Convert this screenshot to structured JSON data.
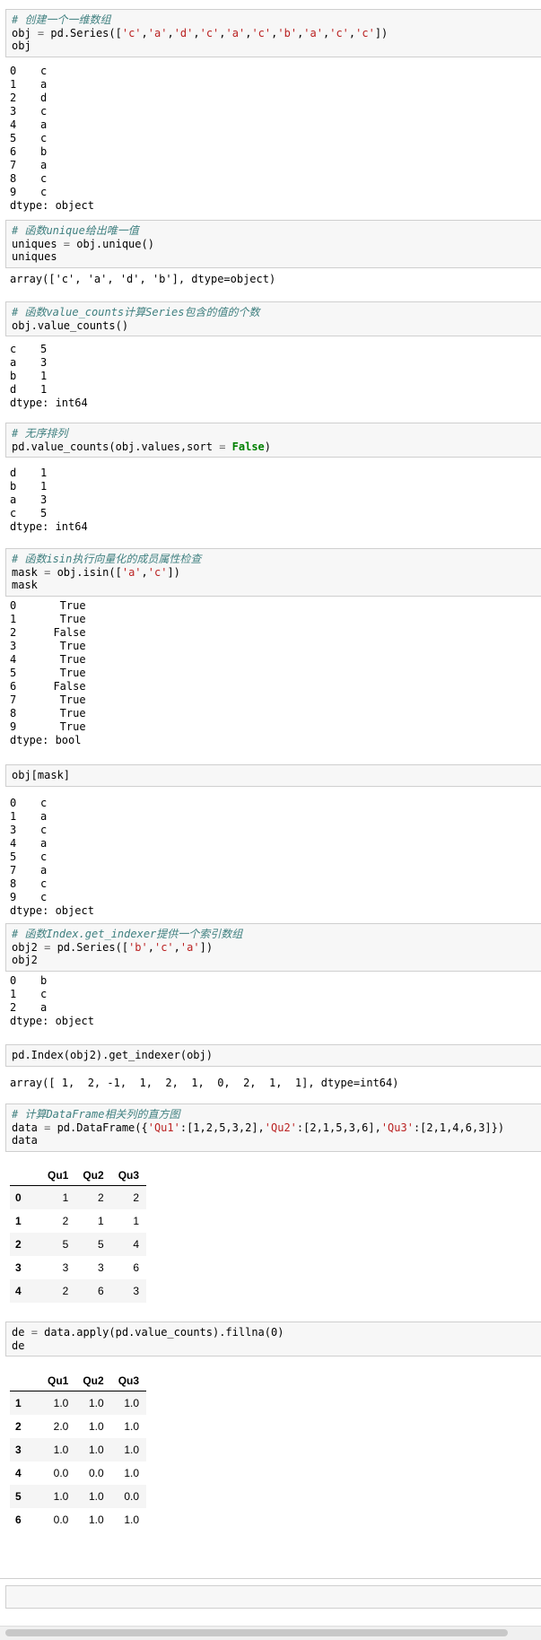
{
  "cells": [
    {
      "input": [
        [
          {
            "t": "# 创建一个一维数组",
            "c": "cm"
          }
        ],
        [
          {
            "t": "obj "
          },
          {
            "t": "=",
            "c": "op"
          },
          {
            "t": " pd.Series(["
          },
          {
            "t": "'c'",
            "c": "st"
          },
          {
            "t": ","
          },
          {
            "t": "'a'",
            "c": "st"
          },
          {
            "t": ","
          },
          {
            "t": "'d'",
            "c": "st"
          },
          {
            "t": ","
          },
          {
            "t": "'c'",
            "c": "st"
          },
          {
            "t": ","
          },
          {
            "t": "'a'",
            "c": "st"
          },
          {
            "t": ","
          },
          {
            "t": "'c'",
            "c": "st"
          },
          {
            "t": ","
          },
          {
            "t": "'b'",
            "c": "st"
          },
          {
            "t": ","
          },
          {
            "t": "'a'",
            "c": "st"
          },
          {
            "t": ","
          },
          {
            "t": "'c'",
            "c": "st"
          },
          {
            "t": ","
          },
          {
            "t": "'c'",
            "c": "st"
          },
          {
            "t": "])"
          }
        ],
        [
          {
            "t": "obj"
          }
        ]
      ],
      "output": {
        "series": [
          [
            "0",
            "c"
          ],
          [
            "1",
            "a"
          ],
          [
            "2",
            "d"
          ],
          [
            "3",
            "c"
          ],
          [
            "4",
            "a"
          ],
          [
            "5",
            "c"
          ],
          [
            "6",
            "b"
          ],
          [
            "7",
            "a"
          ],
          [
            "8",
            "c"
          ],
          [
            "9",
            "c"
          ]
        ],
        "dtype": "dtype: object"
      }
    },
    {
      "input": [
        [
          {
            "t": "# 函数unique给出唯一值",
            "c": "cm"
          }
        ],
        [
          {
            "t": "uniques "
          },
          {
            "t": "=",
            "c": "op"
          },
          {
            "t": " obj.unique()"
          }
        ],
        [
          {
            "t": "uniques"
          }
        ]
      ],
      "output": {
        "text": [
          "array(['c', 'a', 'd', 'b'], dtype=object)"
        ]
      }
    },
    {
      "input": [
        [
          {
            "t": "# 函数value_counts计算Series包含的值的个数",
            "c": "cm"
          }
        ],
        [
          {
            "t": "obj.value_counts()"
          }
        ]
      ],
      "output": {
        "series": [
          [
            "c",
            "5"
          ],
          [
            "a",
            "3"
          ],
          [
            "b",
            "1"
          ],
          [
            "d",
            "1"
          ]
        ],
        "dtype": "dtype: int64"
      }
    },
    {
      "input": [
        [
          {
            "t": "# 无序排列",
            "c": "cm"
          }
        ],
        [
          {
            "t": "pd.value_counts(obj.values,sort "
          },
          {
            "t": "=",
            "c": "op"
          },
          {
            "t": " "
          },
          {
            "t": "False",
            "c": "kw"
          },
          {
            "t": ")"
          }
        ]
      ],
      "output": {
        "series": [
          [
            "d",
            "1"
          ],
          [
            "b",
            "1"
          ],
          [
            "a",
            "3"
          ],
          [
            "c",
            "5"
          ]
        ],
        "dtype": "dtype: int64"
      }
    },
    {
      "input": [
        [
          {
            "t": "# 函数isin执行向量化的成员属性检查",
            "c": "cm"
          }
        ],
        [
          {
            "t": "mask "
          },
          {
            "t": "=",
            "c": "op"
          },
          {
            "t": " obj.isin(["
          },
          {
            "t": "'a'",
            "c": "st"
          },
          {
            "t": ","
          },
          {
            "t": "'c'",
            "c": "st"
          },
          {
            "t": "])"
          }
        ],
        [
          {
            "t": "mask"
          }
        ]
      ],
      "output": {
        "series": [
          [
            "0",
            "   True"
          ],
          [
            "1",
            "   True"
          ],
          [
            "2",
            "  False"
          ],
          [
            "3",
            "   True"
          ],
          [
            "4",
            "   True"
          ],
          [
            "5",
            "   True"
          ],
          [
            "6",
            "  False"
          ],
          [
            "7",
            "   True"
          ],
          [
            "8",
            "   True"
          ],
          [
            "9",
            "   True"
          ]
        ],
        "dtype": "dtype: bool"
      }
    },
    {
      "input": [
        [
          {
            "t": "obj[mask]"
          }
        ]
      ],
      "output": {
        "series": [
          [
            "0",
            "c"
          ],
          [
            "1",
            "a"
          ],
          [
            "3",
            "c"
          ],
          [
            "4",
            "a"
          ],
          [
            "5",
            "c"
          ],
          [
            "7",
            "a"
          ],
          [
            "8",
            "c"
          ],
          [
            "9",
            "c"
          ]
        ],
        "dtype": "dtype: object"
      }
    },
    {
      "input": [
        [
          {
            "t": "# 函数Index.get_indexer提供一个索引数组",
            "c": "cm"
          }
        ],
        [
          {
            "t": "obj2 "
          },
          {
            "t": "=",
            "c": "op"
          },
          {
            "t": " pd.Series(["
          },
          {
            "t": "'b'",
            "c": "st"
          },
          {
            "t": ","
          },
          {
            "t": "'c'",
            "c": "st"
          },
          {
            "t": ","
          },
          {
            "t": "'a'",
            "c": "st"
          },
          {
            "t": "])"
          }
        ],
        [
          {
            "t": "obj2"
          }
        ]
      ],
      "output": {
        "series": [
          [
            "0",
            "b"
          ],
          [
            "1",
            "c"
          ],
          [
            "2",
            "a"
          ]
        ],
        "dtype": "dtype: object"
      }
    },
    {
      "input": [
        [
          {
            "t": "pd.Index(obj2).get_indexer(obj)"
          }
        ]
      ],
      "output": {
        "text": [
          "array([ 1,  2, -1,  1,  2,  1,  0,  2,  1,  1], dtype=int64)"
        ]
      }
    },
    {
      "input": [
        [
          {
            "t": "# 计算DataFrame相关列的直方图",
            "c": "cm"
          }
        ],
        [
          {
            "t": "data "
          },
          {
            "t": "=",
            "c": "op"
          },
          {
            "t": " pd.DataFrame({"
          },
          {
            "t": "'Qu1'",
            "c": "st"
          },
          {
            "t": ":[1,2,5,3,2],"
          },
          {
            "t": "'Qu2'",
            "c": "st"
          },
          {
            "t": ":[2,1,5,3,6],"
          },
          {
            "t": "'Qu3'",
            "c": "st"
          },
          {
            "t": ":[2,1,4,6,3]})"
          }
        ],
        [
          {
            "t": "data"
          }
        ]
      ],
      "output": {
        "table": {
          "columns": [
            "",
            "Qu1",
            "Qu2",
            "Qu3"
          ],
          "rows": [
            [
              "0",
              "1",
              "2",
              "2"
            ],
            [
              "1",
              "2",
              "1",
              "1"
            ],
            [
              "2",
              "5",
              "5",
              "4"
            ],
            [
              "3",
              "3",
              "3",
              "6"
            ],
            [
              "4",
              "2",
              "6",
              "3"
            ]
          ]
        }
      }
    },
    {
      "input": [
        [
          {
            "t": "de "
          },
          {
            "t": "=",
            "c": "op"
          },
          {
            "t": " data.apply(pd.value_counts).fillna(0)"
          }
        ],
        [
          {
            "t": "de"
          }
        ]
      ],
      "output": {
        "table": {
          "columns": [
            "",
            "Qu1",
            "Qu2",
            "Qu3"
          ],
          "rows": [
            [
              "1",
              "1.0",
              "1.0",
              "1.0"
            ],
            [
              "2",
              "2.0",
              "1.0",
              "1.0"
            ],
            [
              "3",
              "1.0",
              "1.0",
              "1.0"
            ],
            [
              "4",
              "0.0",
              "0.0",
              "1.0"
            ],
            [
              "5",
              "1.0",
              "1.0",
              "0.0"
            ],
            [
              "6",
              "0.0",
              "1.0",
              "1.0"
            ]
          ]
        }
      }
    }
  ]
}
